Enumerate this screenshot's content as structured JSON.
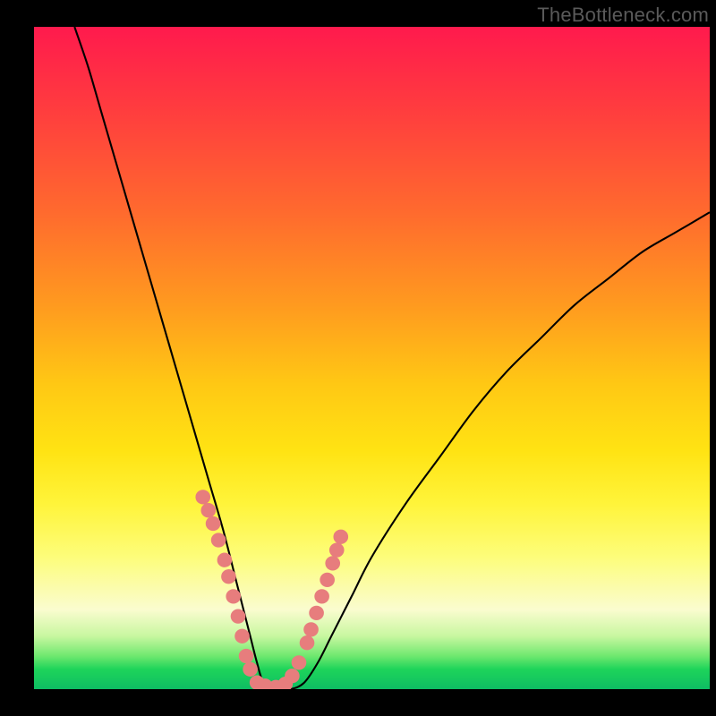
{
  "watermark": "TheBottleneck.com",
  "chart_data": {
    "type": "line",
    "title": "",
    "xlabel": "",
    "ylabel": "",
    "xlim": [
      0,
      100
    ],
    "ylim": [
      0,
      100
    ],
    "grid": false,
    "series": [
      {
        "name": "curve",
        "x": [
          6,
          8,
          10,
          12,
          14,
          16,
          18,
          20,
          22,
          24,
          26,
          28,
          30,
          31,
          32,
          33,
          34,
          36,
          38,
          40,
          42,
          44,
          47,
          50,
          55,
          60,
          65,
          70,
          75,
          80,
          85,
          90,
          95,
          100
        ],
        "y": [
          100,
          94,
          87,
          80,
          73,
          66,
          59,
          52,
          45,
          38,
          31,
          24,
          16,
          12,
          8,
          4,
          1,
          0,
          0,
          1,
          4,
          8,
          14,
          20,
          28,
          35,
          42,
          48,
          53,
          58,
          62,
          66,
          69,
          72
        ]
      }
    ],
    "markers": {
      "name": "dot-cluster",
      "color": "#e77d7d",
      "x": [
        25.0,
        25.8,
        26.5,
        27.3,
        28.2,
        28.8,
        29.5,
        30.2,
        30.8,
        31.4,
        32.0,
        33.0,
        34.2,
        35.8,
        37.2,
        38.2,
        39.2,
        40.4,
        41.0,
        41.8,
        42.6,
        43.4,
        44.2,
        44.8,
        45.4
      ],
      "y": [
        29.0,
        27.0,
        25.0,
        22.5,
        19.5,
        17.0,
        14.0,
        11.0,
        8.0,
        5.0,
        3.0,
        1.0,
        0.5,
        0.3,
        0.8,
        2.0,
        4.0,
        7.0,
        9.0,
        11.5,
        14.0,
        16.5,
        19.0,
        21.0,
        23.0
      ],
      "radius": 1.1
    }
  }
}
